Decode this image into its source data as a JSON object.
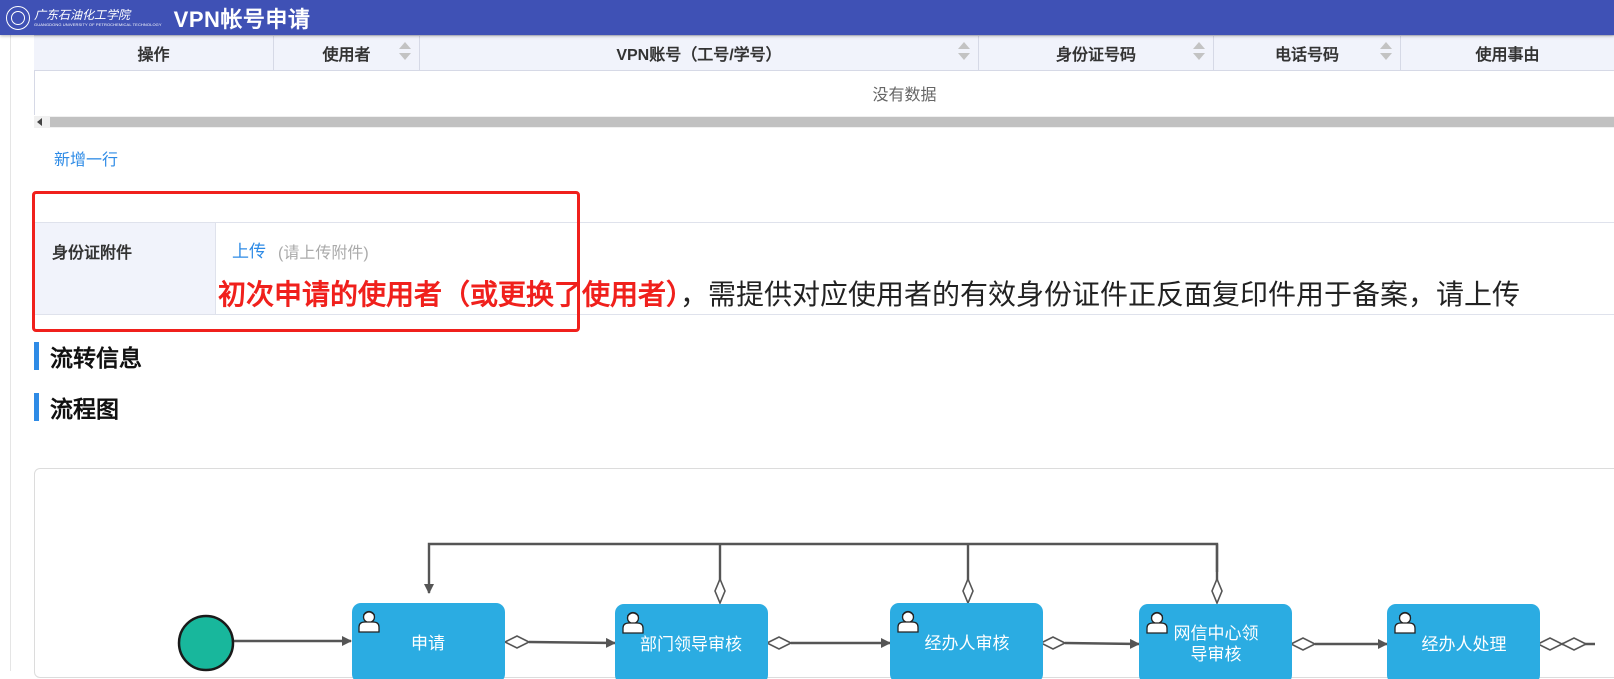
{
  "header": {
    "logo_cn": "广东石油化工学院",
    "logo_en": "GUANGDONG UNIVERSITY OF PETROCHEMICAL TECHNOLOGY",
    "title": "VPN帐号申请",
    "bg_color": "#3f51b5"
  },
  "grid": {
    "columns": [
      "操作",
      "使用者",
      "VPN账号（工号/学号）",
      "身份证号码",
      "电话号码",
      "使用事由"
    ],
    "empty_text": "没有数据",
    "add_row_label": "新增一行"
  },
  "attachment": {
    "label": "身份证附件",
    "upload_label": "上传",
    "upload_hint": "(请上传附件)",
    "notice_emphasis": "初次申请的使用者（或更换了使用者）",
    "notice_rest": "，需提供对应使用者的有效身份证件正反面复印件用于备案，请上传"
  },
  "sections": {
    "flow_info": "流转信息",
    "flow_chart": "流程图"
  },
  "flow": {
    "nodes": [
      {
        "label": "申请",
        "label2": ""
      },
      {
        "label": "部门领导审核",
        "label2": ""
      },
      {
        "label": "经办人审核",
        "label2": ""
      },
      {
        "label": "网信中心领",
        "label2": "导审核"
      },
      {
        "label": "经办人处理",
        "label2": ""
      }
    ],
    "node_color": "#2bace2",
    "start_color": "#18b79c",
    "line_color": "#555555"
  },
  "colors": {
    "accent": "#2e8be6",
    "highlight": "#f0201c"
  }
}
